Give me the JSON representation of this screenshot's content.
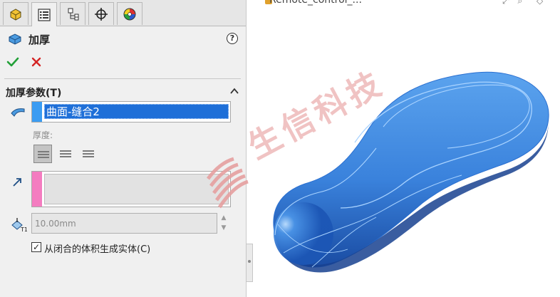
{
  "tabs": [
    {
      "name": "feature-manager",
      "icon": "feature-tree-icon"
    },
    {
      "name": "property-manager",
      "icon": "property-list-icon"
    },
    {
      "name": "configuration-manager",
      "icon": "configuration-icon"
    },
    {
      "name": "dimxpert-manager",
      "icon": "crosshair-icon"
    },
    {
      "name": "display-manager",
      "icon": "appearance-wheel-icon"
    }
  ],
  "header": {
    "title": "加厚",
    "help": "?"
  },
  "section": {
    "title": "加厚参数(T)"
  },
  "surface_list": {
    "selected": "曲面-缝合2"
  },
  "thickness_side": {
    "label": "厚度:",
    "active_index": 0
  },
  "thickness": {
    "value": "10.00mm"
  },
  "checkbox": {
    "label": "从闭合的体积生成实体(C)",
    "checked": true,
    "mark": "☑"
  },
  "document": {
    "name": "Remote_control_..."
  },
  "watermark": {
    "text": "生信科技"
  },
  "colors": {
    "accent": "#1e6fd8",
    "model": "#3a86dd",
    "ok": "#22a038",
    "cancel": "#d42424"
  }
}
